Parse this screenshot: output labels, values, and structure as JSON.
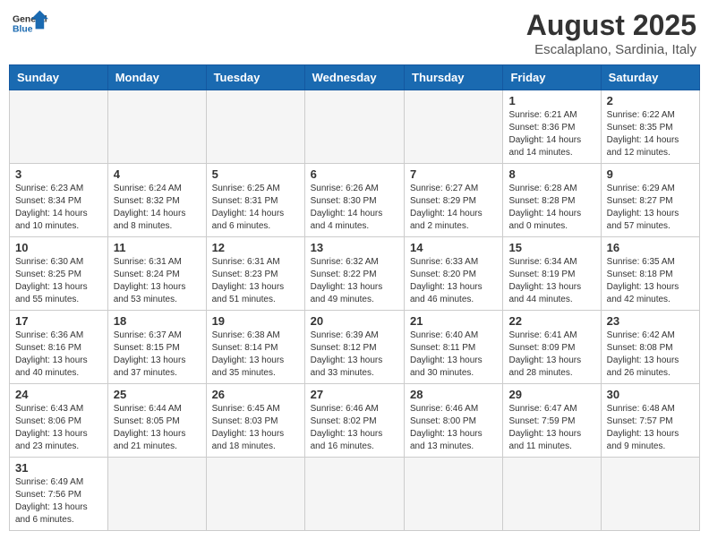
{
  "header": {
    "logo_general": "General",
    "logo_blue": "Blue",
    "title": "August 2025",
    "subtitle": "Escalaplano, Sardinia, Italy"
  },
  "weekdays": [
    "Sunday",
    "Monday",
    "Tuesday",
    "Wednesday",
    "Thursday",
    "Friday",
    "Saturday"
  ],
  "weeks": [
    [
      {
        "day": "",
        "info": ""
      },
      {
        "day": "",
        "info": ""
      },
      {
        "day": "",
        "info": ""
      },
      {
        "day": "",
        "info": ""
      },
      {
        "day": "",
        "info": ""
      },
      {
        "day": "1",
        "info": "Sunrise: 6:21 AM\nSunset: 8:36 PM\nDaylight: 14 hours\nand 14 minutes."
      },
      {
        "day": "2",
        "info": "Sunrise: 6:22 AM\nSunset: 8:35 PM\nDaylight: 14 hours\nand 12 minutes."
      }
    ],
    [
      {
        "day": "3",
        "info": "Sunrise: 6:23 AM\nSunset: 8:34 PM\nDaylight: 14 hours\nand 10 minutes."
      },
      {
        "day": "4",
        "info": "Sunrise: 6:24 AM\nSunset: 8:32 PM\nDaylight: 14 hours\nand 8 minutes."
      },
      {
        "day": "5",
        "info": "Sunrise: 6:25 AM\nSunset: 8:31 PM\nDaylight: 14 hours\nand 6 minutes."
      },
      {
        "day": "6",
        "info": "Sunrise: 6:26 AM\nSunset: 8:30 PM\nDaylight: 14 hours\nand 4 minutes."
      },
      {
        "day": "7",
        "info": "Sunrise: 6:27 AM\nSunset: 8:29 PM\nDaylight: 14 hours\nand 2 minutes."
      },
      {
        "day": "8",
        "info": "Sunrise: 6:28 AM\nSunset: 8:28 PM\nDaylight: 14 hours\nand 0 minutes."
      },
      {
        "day": "9",
        "info": "Sunrise: 6:29 AM\nSunset: 8:27 PM\nDaylight: 13 hours\nand 57 minutes."
      }
    ],
    [
      {
        "day": "10",
        "info": "Sunrise: 6:30 AM\nSunset: 8:25 PM\nDaylight: 13 hours\nand 55 minutes."
      },
      {
        "day": "11",
        "info": "Sunrise: 6:31 AM\nSunset: 8:24 PM\nDaylight: 13 hours\nand 53 minutes."
      },
      {
        "day": "12",
        "info": "Sunrise: 6:31 AM\nSunset: 8:23 PM\nDaylight: 13 hours\nand 51 minutes."
      },
      {
        "day": "13",
        "info": "Sunrise: 6:32 AM\nSunset: 8:22 PM\nDaylight: 13 hours\nand 49 minutes."
      },
      {
        "day": "14",
        "info": "Sunrise: 6:33 AM\nSunset: 8:20 PM\nDaylight: 13 hours\nand 46 minutes."
      },
      {
        "day": "15",
        "info": "Sunrise: 6:34 AM\nSunset: 8:19 PM\nDaylight: 13 hours\nand 44 minutes."
      },
      {
        "day": "16",
        "info": "Sunrise: 6:35 AM\nSunset: 8:18 PM\nDaylight: 13 hours\nand 42 minutes."
      }
    ],
    [
      {
        "day": "17",
        "info": "Sunrise: 6:36 AM\nSunset: 8:16 PM\nDaylight: 13 hours\nand 40 minutes."
      },
      {
        "day": "18",
        "info": "Sunrise: 6:37 AM\nSunset: 8:15 PM\nDaylight: 13 hours\nand 37 minutes."
      },
      {
        "day": "19",
        "info": "Sunrise: 6:38 AM\nSunset: 8:14 PM\nDaylight: 13 hours\nand 35 minutes."
      },
      {
        "day": "20",
        "info": "Sunrise: 6:39 AM\nSunset: 8:12 PM\nDaylight: 13 hours\nand 33 minutes."
      },
      {
        "day": "21",
        "info": "Sunrise: 6:40 AM\nSunset: 8:11 PM\nDaylight: 13 hours\nand 30 minutes."
      },
      {
        "day": "22",
        "info": "Sunrise: 6:41 AM\nSunset: 8:09 PM\nDaylight: 13 hours\nand 28 minutes."
      },
      {
        "day": "23",
        "info": "Sunrise: 6:42 AM\nSunset: 8:08 PM\nDaylight: 13 hours\nand 26 minutes."
      }
    ],
    [
      {
        "day": "24",
        "info": "Sunrise: 6:43 AM\nSunset: 8:06 PM\nDaylight: 13 hours\nand 23 minutes."
      },
      {
        "day": "25",
        "info": "Sunrise: 6:44 AM\nSunset: 8:05 PM\nDaylight: 13 hours\nand 21 minutes."
      },
      {
        "day": "26",
        "info": "Sunrise: 6:45 AM\nSunset: 8:03 PM\nDaylight: 13 hours\nand 18 minutes."
      },
      {
        "day": "27",
        "info": "Sunrise: 6:46 AM\nSunset: 8:02 PM\nDaylight: 13 hours\nand 16 minutes."
      },
      {
        "day": "28",
        "info": "Sunrise: 6:46 AM\nSunset: 8:00 PM\nDaylight: 13 hours\nand 13 minutes."
      },
      {
        "day": "29",
        "info": "Sunrise: 6:47 AM\nSunset: 7:59 PM\nDaylight: 13 hours\nand 11 minutes."
      },
      {
        "day": "30",
        "info": "Sunrise: 6:48 AM\nSunset: 7:57 PM\nDaylight: 13 hours\nand 9 minutes."
      }
    ],
    [
      {
        "day": "31",
        "info": "Sunrise: 6:49 AM\nSunset: 7:56 PM\nDaylight: 13 hours\nand 6 minutes."
      },
      {
        "day": "",
        "info": ""
      },
      {
        "day": "",
        "info": ""
      },
      {
        "day": "",
        "info": ""
      },
      {
        "day": "",
        "info": ""
      },
      {
        "day": "",
        "info": ""
      },
      {
        "day": "",
        "info": ""
      }
    ]
  ]
}
